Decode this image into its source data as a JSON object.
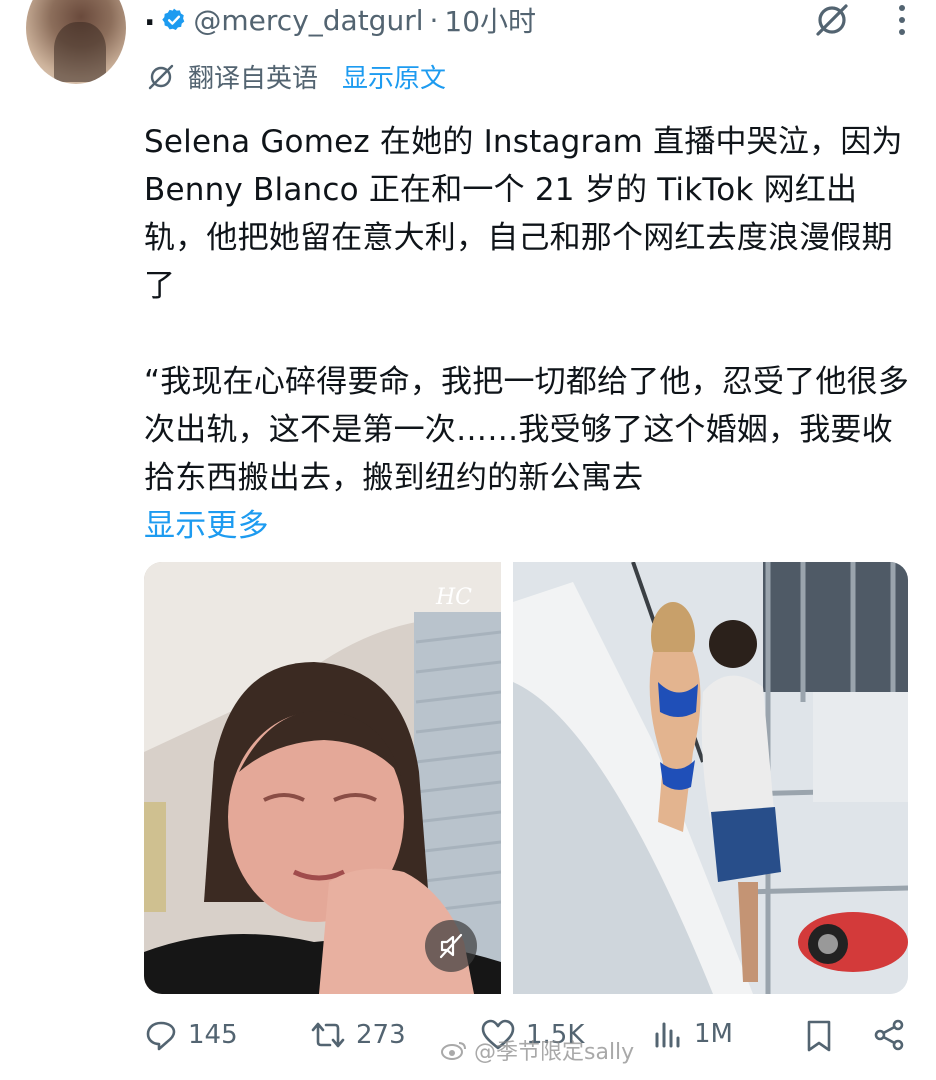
{
  "header": {
    "display_name": ".",
    "handle": "@mercy_datgurl",
    "separator": "·",
    "time": "10小时"
  },
  "translation": {
    "label": "翻译自英语",
    "show_original": "显示原文"
  },
  "tweet": {
    "paragraph1": "Selena Gomez 在她的 Instagram 直播中哭泣，因为 Benny Blanco 正在和一个 21 岁的 TikTok 网红出轨，他把她留在意大利，自己和那个网红去度浪漫假期了",
    "paragraph2": "“我现在心碎得要命，我把一切都给了他，忍受了他很多次出轨，这不是第一次……我受够了这个婚姻，我要收拾东西搬出去，搬到纽约的新公寓去",
    "show_more": "显示更多"
  },
  "media": {
    "left_watermark": "HC"
  },
  "actions": {
    "replies": "145",
    "retweets": "273",
    "likes": "1.5K",
    "views": "1M"
  },
  "watermark": {
    "text": "@季节限定sally"
  },
  "colors": {
    "accent": "#1d9bf0",
    "muted": "#536471"
  }
}
